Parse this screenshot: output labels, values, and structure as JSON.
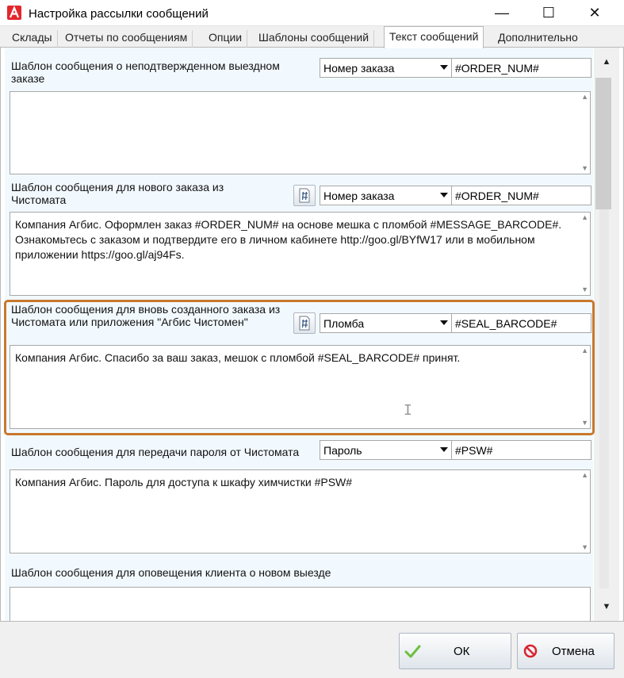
{
  "window": {
    "title": "Настройка рассылки сообщений",
    "app_icon": "agbis-logo-icon"
  },
  "controls": {
    "minimize": "—",
    "maximize": "☐",
    "close": "✕"
  },
  "tabs": [
    {
      "label": "Склады"
    },
    {
      "label": "Отчеты по сообщениям"
    },
    {
      "label": "Опции"
    },
    {
      "label": "Шаблоны сообщений"
    },
    {
      "label": "Текст сообщений",
      "active": true
    },
    {
      "label": "Дополнительно"
    }
  ],
  "templates": [
    {
      "label": "Шаблон сообщения о неподтвержденном выездном заказе",
      "combo": "Номер заказа",
      "macro": "#ORDER_NUM#",
      "text": ""
    },
    {
      "label": "Шаблон сообщения для нового заказа из Чистомата",
      "combo": "Номер заказа",
      "macro": "#ORDER_NUM#",
      "text": "Компания Агбис. Оформлен заказ #ORDER_NUM# на основе мешка с пломбой #MESSAGE_BARCODE#. Ознакомьтесь с заказом и подтвердите его в личном кабинете http://goo.gl/BYfW17 или в мобильном приложении https://goo.gl/aj94Fs."
    },
    {
      "label": "Шаблон сообщения для вновь созданного заказа из Чистомата или приложения \"Агбис Чистомен\"",
      "combo": "Пломба",
      "macro": "#SEAL_BARCODE#",
      "text": "Компания Агбис. Спасибо за ваш заказ, мешок с пломбой #SEAL_BARCODE# принят."
    },
    {
      "label": "Шаблон сообщения для передачи пароля от Чистомата",
      "combo": "Пароль",
      "macro": "#PSW#",
      "text": "Компания Агбис. Пароль для доступа к шкафу химчистки #PSW#"
    },
    {
      "label": "Шаблон сообщения для оповещения клиента о новом выезде",
      "text": ""
    }
  ],
  "footer": {
    "ok_label": "ОК",
    "cancel_label": "Отмена"
  },
  "colors": {
    "highlight": "#c8782d",
    "panel": "#f2f9fe",
    "ok_check": "#6dbf3e",
    "cancel_icon": "#d9232d"
  }
}
